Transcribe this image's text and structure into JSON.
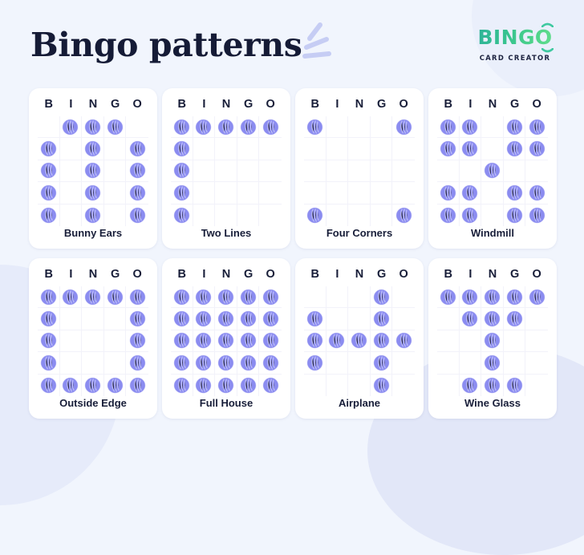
{
  "header": {
    "title": "Bingo patterns",
    "sparkle_icon": "sparkle-dashes-icon",
    "sparkle_color": "#c6cdf4"
  },
  "logo": {
    "wordmark": "BINGO",
    "subtitle": "CARD CREATOR",
    "gradient_start": "#2fb398",
    "gradient_end": "#63dd8d",
    "accent_icon": "curved-accent-icon"
  },
  "theme": {
    "background": "#f1f5fd",
    "card_background": "#ffffff",
    "dauber_color": "#8b8cf0",
    "dauber_highlight": "#c3c4fb",
    "text_color": "#171d38",
    "grid_line": "#f2f2fa",
    "blob_color": "#e6ebfa"
  },
  "columns": [
    "B",
    "I",
    "N",
    "G",
    "O"
  ],
  "cards": [
    {
      "label": "Bunny Ears",
      "marks": [
        [
          0,
          1,
          1,
          1,
          0
        ],
        [
          1,
          0,
          1,
          0,
          1
        ],
        [
          1,
          0,
          1,
          0,
          1
        ],
        [
          1,
          0,
          1,
          0,
          1
        ],
        [
          1,
          0,
          1,
          0,
          1
        ]
      ]
    },
    {
      "label": "Two Lines",
      "marks": [
        [
          1,
          1,
          1,
          1,
          1
        ],
        [
          1,
          0,
          0,
          0,
          0
        ],
        [
          1,
          0,
          0,
          0,
          0
        ],
        [
          1,
          0,
          0,
          0,
          0
        ],
        [
          1,
          0,
          0,
          0,
          0
        ]
      ]
    },
    {
      "label": "Four Corners",
      "marks": [
        [
          1,
          0,
          0,
          0,
          1
        ],
        [
          0,
          0,
          0,
          0,
          0
        ],
        [
          0,
          0,
          0,
          0,
          0
        ],
        [
          0,
          0,
          0,
          0,
          0
        ],
        [
          1,
          0,
          0,
          0,
          1
        ]
      ]
    },
    {
      "label": "Windmill",
      "marks": [
        [
          1,
          1,
          0,
          1,
          1
        ],
        [
          1,
          1,
          0,
          1,
          1
        ],
        [
          0,
          0,
          1,
          0,
          0
        ],
        [
          1,
          1,
          0,
          1,
          1
        ],
        [
          1,
          1,
          0,
          1,
          1
        ]
      ]
    },
    {
      "label": "Outside Edge",
      "marks": [
        [
          1,
          1,
          1,
          1,
          1
        ],
        [
          1,
          0,
          0,
          0,
          1
        ],
        [
          1,
          0,
          0,
          0,
          1
        ],
        [
          1,
          0,
          0,
          0,
          1
        ],
        [
          1,
          1,
          1,
          1,
          1
        ]
      ]
    },
    {
      "label": "Full House",
      "marks": [
        [
          1,
          1,
          1,
          1,
          1
        ],
        [
          1,
          1,
          1,
          1,
          1
        ],
        [
          1,
          1,
          1,
          1,
          1
        ],
        [
          1,
          1,
          1,
          1,
          1
        ],
        [
          1,
          1,
          1,
          1,
          1
        ]
      ]
    },
    {
      "label": "Airplane",
      "marks": [
        [
          0,
          0,
          0,
          1,
          0
        ],
        [
          1,
          0,
          0,
          1,
          0
        ],
        [
          1,
          1,
          1,
          1,
          1
        ],
        [
          1,
          0,
          0,
          1,
          0
        ],
        [
          0,
          0,
          0,
          1,
          0
        ]
      ]
    },
    {
      "label": "Wine Glass",
      "marks": [
        [
          1,
          1,
          1,
          1,
          1
        ],
        [
          0,
          1,
          1,
          1,
          0
        ],
        [
          0,
          0,
          1,
          0,
          0
        ],
        [
          0,
          0,
          1,
          0,
          0
        ],
        [
          0,
          1,
          1,
          1,
          0
        ]
      ]
    }
  ]
}
